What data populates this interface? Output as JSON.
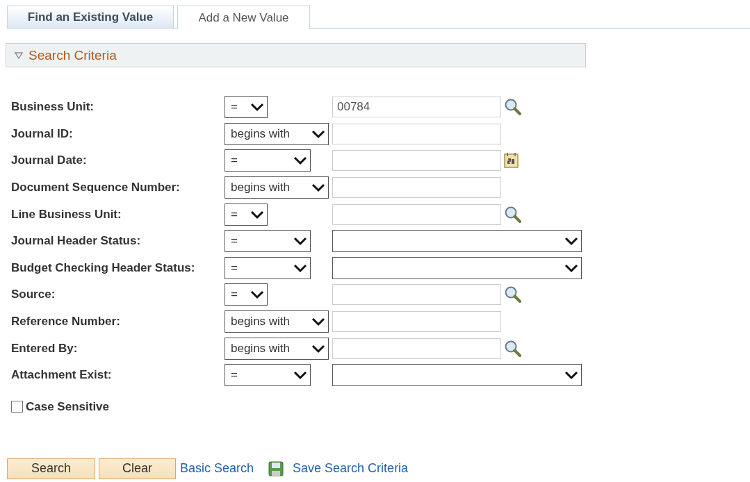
{
  "tabs": [
    {
      "label": "Find an Existing Value",
      "selected": true
    },
    {
      "label": "Add a New Value",
      "selected": false
    }
  ],
  "section": {
    "title": "Search Criteria",
    "expanded": true
  },
  "fields": [
    {
      "label": "Business Unit:",
      "operator": "=",
      "kind": "text",
      "value": "00784"
    },
    {
      "label": "Journal ID:",
      "operator": "begins with",
      "kind": "text"
    },
    {
      "label": "Journal Date:",
      "operator": "=",
      "kind": "text"
    },
    {
      "label": "Document Sequence Number:",
      "operator": "begins with",
      "kind": "text"
    },
    {
      "label": "Line Business Unit:",
      "operator": "=",
      "kind": "text"
    },
    {
      "label": "Journal Header Status:",
      "operator": "=",
      "kind": "dropdown"
    },
    {
      "label": "Budget Checking Header Status:",
      "operator": "=",
      "kind": "dropdown"
    },
    {
      "label": "Source:",
      "operator": "=",
      "kind": "text"
    },
    {
      "label": "Reference Number:",
      "operator": "begins with",
      "kind": "text"
    },
    {
      "label": "Entered By:",
      "operator": "begins with",
      "kind": "text"
    },
    {
      "label": "Attachment Exist:",
      "operator": "=",
      "kind": "dropdown"
    }
  ],
  "case_sensitive": {
    "label": "Case Sensitive",
    "checked": false
  },
  "buttons": [
    "Search",
    "Clear"
  ],
  "links": [
    "Basic Search",
    "Save Search Criteria"
  ]
}
